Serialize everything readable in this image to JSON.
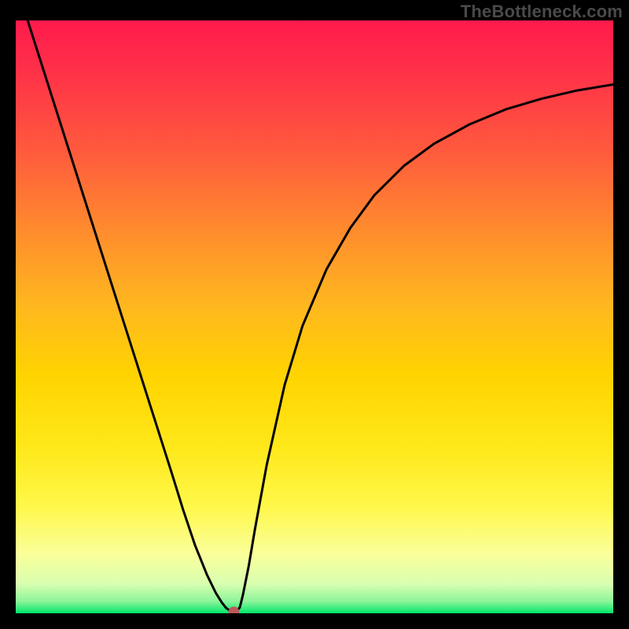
{
  "watermark": "TheBottleneck.com",
  "chart_data": {
    "type": "line",
    "title": "",
    "xlabel": "",
    "ylabel": "",
    "xlim": [
      0,
      100
    ],
    "ylim": [
      0,
      100
    ],
    "background_gradient": {
      "top_color": "#ff1a4d",
      "mid_colors": [
        "#ff6a33",
        "#ffd000",
        "#ffeb33",
        "#f6ffb3"
      ],
      "bottom_color": "#00e56a"
    },
    "series": [
      {
        "name": "curve",
        "color": "#000000",
        "x": [
          2,
          5,
          8,
          11,
          14,
          17,
          20,
          23,
          26,
          28,
          30,
          32,
          33.5,
          34.5,
          35.2,
          36,
          36.5,
          37,
          37.5,
          38,
          39,
          40,
          42,
          45,
          48,
          52,
          56,
          60,
          65,
          70,
          76,
          82,
          88,
          94,
          100
        ],
        "y": [
          100,
          90.5,
          81,
          71.5,
          62,
          52.5,
          43,
          33.5,
          24,
          17.5,
          11.5,
          6.5,
          3.4,
          1.8,
          0.9,
          0.35,
          0.2,
          0.35,
          1,
          3,
          8,
          14,
          25,
          38.5,
          48.5,
          58,
          65,
          70.5,
          75.5,
          79.2,
          82.5,
          85,
          86.8,
          88.2,
          89.2
        ]
      }
    ],
    "marker": {
      "x": 36.5,
      "y": 0.2,
      "color": "#b85a5a",
      "radius_px": 7
    }
  }
}
